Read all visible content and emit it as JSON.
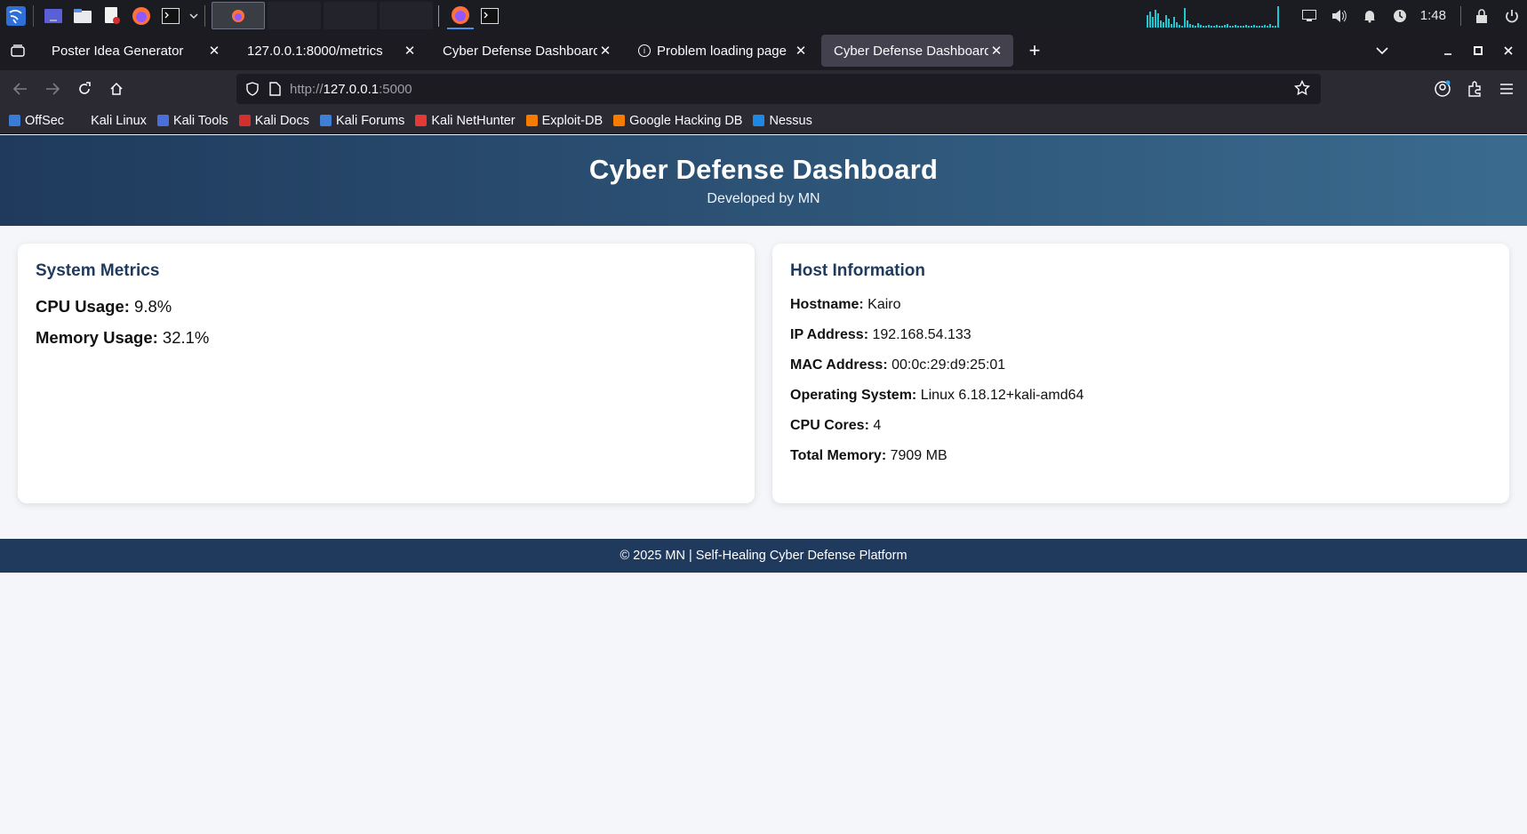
{
  "taskbar": {
    "clock": "1:48"
  },
  "browser": {
    "tabs": [
      {
        "title": "Poster Idea Generator",
        "selected": false,
        "icon": ""
      },
      {
        "title": "127.0.0.1:8000/metrics",
        "selected": false,
        "icon": ""
      },
      {
        "title": "Cyber Defense Dashboard - M",
        "selected": false,
        "icon": ""
      },
      {
        "title": "Problem loading page",
        "selected": false,
        "icon": "info-icon"
      },
      {
        "title": "Cyber Defense Dashboard - M",
        "selected": true,
        "icon": ""
      }
    ],
    "url_scheme": "http://",
    "url_host": "127.0.0.1",
    "url_port": ":5000",
    "bookmarks": [
      {
        "label": "OffSec",
        "color": "#3a7bd5"
      },
      {
        "label": "Kali Linux",
        "color": "#2b2a33"
      },
      {
        "label": "Kali Tools",
        "color": "#4a6fd8"
      },
      {
        "label": "Kali Docs",
        "color": "#d32f2f"
      },
      {
        "label": "Kali Forums",
        "color": "#3f7fd8"
      },
      {
        "label": "Kali NetHunter",
        "color": "#e53935"
      },
      {
        "label": "Exploit-DB",
        "color": "#f57c00"
      },
      {
        "label": "Google Hacking DB",
        "color": "#f57c00"
      },
      {
        "label": "Nessus",
        "color": "#1e88e5"
      }
    ]
  },
  "page": {
    "title": "Cyber Defense Dashboard",
    "subtitle": "Developed by MN",
    "system_metrics": {
      "heading": "System Metrics",
      "cpu_label": "CPU Usage:",
      "cpu_value": "9.8%",
      "mem_label": "Memory Usage:",
      "mem_value": "32.1%"
    },
    "host_info": {
      "heading": "Host Information",
      "rows": [
        {
          "label": "Hostname:",
          "value": "Kairo"
        },
        {
          "label": "IP Address:",
          "value": "192.168.54.133"
        },
        {
          "label": "MAC Address:",
          "value": "00:0c:29:d9:25:01"
        },
        {
          "label": "Operating System:",
          "value": "Linux 6.18.12+kali-amd64"
        },
        {
          "label": "CPU Cores:",
          "value": "4"
        },
        {
          "label": "Total Memory:",
          "value": "7909 MB"
        }
      ]
    },
    "footer": "© 2025 MN | Self-Healing Cyber Defense Platform"
  }
}
